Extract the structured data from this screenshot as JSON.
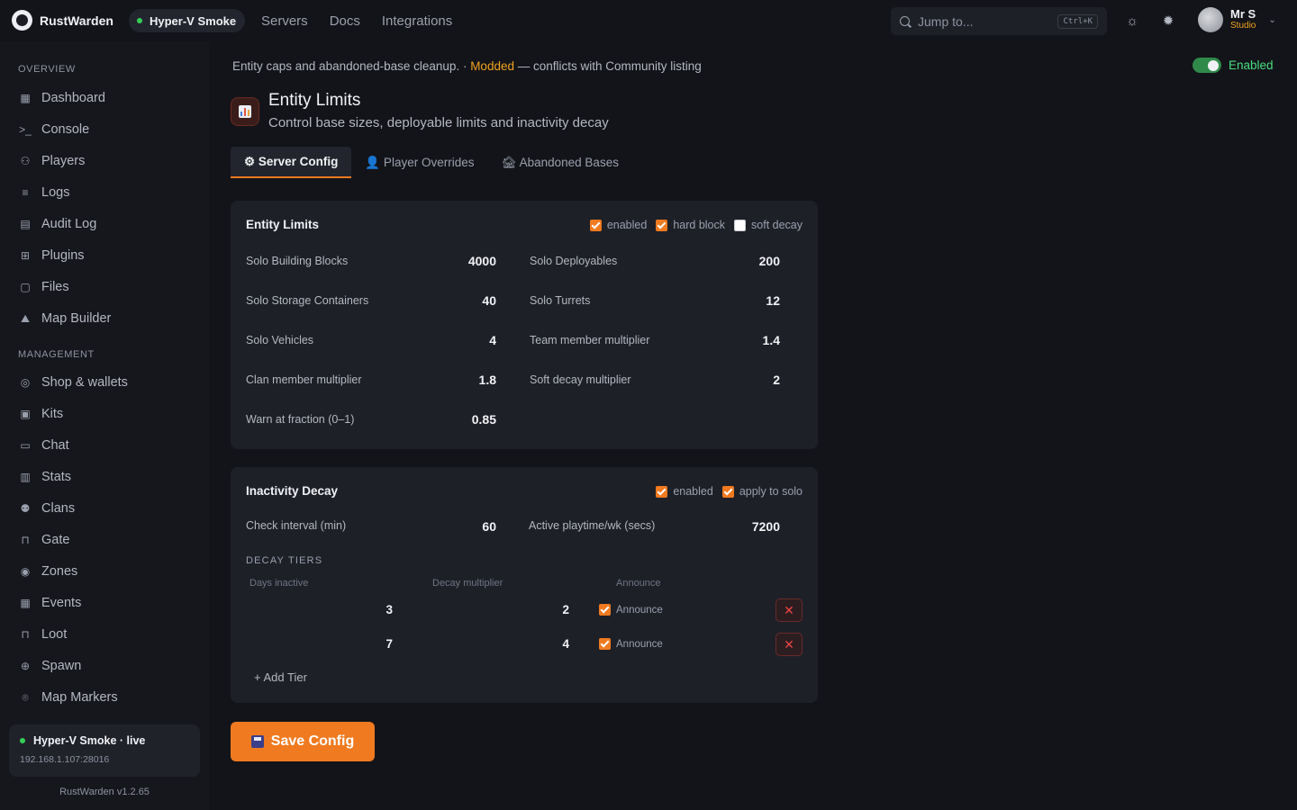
{
  "brand": {
    "name": "RustWarden"
  },
  "server_pill": {
    "label": "Hyper-V Smoke"
  },
  "topnav": [
    "Servers",
    "Docs",
    "Integrations"
  ],
  "search": {
    "placeholder": "Jump to...",
    "shortcut": "Ctrl+K"
  },
  "user": {
    "name": "Mr S",
    "role": "Studio"
  },
  "sidebar": {
    "overview_label": "OVERVIEW",
    "overview": [
      {
        "label": "Dashboard",
        "icon": "grid-icon"
      },
      {
        "label": "Console",
        "icon": "terminal-icon"
      },
      {
        "label": "Players",
        "icon": "users-icon"
      },
      {
        "label": "Logs",
        "icon": "list-icon"
      },
      {
        "label": "Audit Log",
        "icon": "clipboard-icon"
      },
      {
        "label": "Plugins",
        "icon": "puzzle-icon"
      },
      {
        "label": "Files",
        "icon": "file-icon"
      },
      {
        "label": "Map Builder",
        "icon": "map-icon"
      }
    ],
    "management_label": "MANAGEMENT",
    "management": [
      {
        "label": "Shop & wallets",
        "icon": "coin-icon"
      },
      {
        "label": "Kits",
        "icon": "package-icon"
      },
      {
        "label": "Chat",
        "icon": "chat-icon"
      },
      {
        "label": "Stats",
        "icon": "bar-chart-icon"
      },
      {
        "label": "Clans",
        "icon": "group-icon"
      },
      {
        "label": "Gate",
        "icon": "lock-icon"
      },
      {
        "label": "Zones",
        "icon": "target-icon"
      },
      {
        "label": "Events",
        "icon": "calendar-icon"
      },
      {
        "label": "Loot",
        "icon": "lock-icon"
      },
      {
        "label": "Spawn",
        "icon": "plus-circle-icon"
      },
      {
        "label": "Map Markers",
        "icon": "pin-icon"
      }
    ],
    "status": {
      "title": "Hyper-V Smoke · live",
      "ip": "192.168.1.107:28016"
    },
    "version": "RustWarden v1.2.65"
  },
  "banner": {
    "text": "Entity caps and abandoned-base cleanup. · ",
    "mod": "Modded",
    "rest": " — conflicts with Community listing",
    "toggle_label": "Enabled"
  },
  "plugin": {
    "title": "Entity Limits",
    "subtitle": "Control base sizes, deployable limits and inactivity decay"
  },
  "tabs": [
    {
      "label": "⚙ Server Config",
      "active": true
    },
    {
      "label": "👤 Player Overrides",
      "active": false
    },
    {
      "label": "🏚 Abandoned Bases",
      "active": false
    }
  ],
  "entity_limits": {
    "title": "Entity Limits",
    "checks": [
      {
        "label": "enabled",
        "checked": true
      },
      {
        "label": "hard block",
        "checked": true
      },
      {
        "label": "soft decay",
        "checked": false
      }
    ],
    "fields": [
      {
        "label": "Solo Building Blocks",
        "value": "4000"
      },
      {
        "label": "Solo Deployables",
        "value": "200"
      },
      {
        "label": "Solo Storage Containers",
        "value": "40"
      },
      {
        "label": "Solo Turrets",
        "value": "12"
      },
      {
        "label": "Solo Vehicles",
        "value": "4"
      },
      {
        "label": "Team member multiplier",
        "value": "1.4"
      },
      {
        "label": "Clan member multiplier",
        "value": "1.8"
      },
      {
        "label": "Soft decay multiplier",
        "value": "2"
      },
      {
        "label": "Warn at fraction (0–1)",
        "value": "0.85"
      }
    ]
  },
  "inactivity": {
    "title": "Inactivity Decay",
    "checks": [
      {
        "label": "enabled",
        "checked": true
      },
      {
        "label": "apply to solo",
        "checked": true
      }
    ],
    "fields": [
      {
        "label": "Check interval (min)",
        "value": "60"
      },
      {
        "label": "Active playtime/wk (secs)",
        "value": "7200"
      }
    ],
    "tiers_label": "DECAY TIERS",
    "columns": [
      "Days inactive",
      "Decay multiplier",
      "Announce"
    ],
    "tiers": [
      {
        "days": "3",
        "multiplier": "2",
        "announce": "Announce",
        "checked": true
      },
      {
        "days": "7",
        "multiplier": "4",
        "announce": "Announce",
        "checked": true
      }
    ],
    "add_label": "+ Add Tier"
  },
  "save_label": "Save Config",
  "colors": {
    "accent": "#f07a1f",
    "success": "#4ade80",
    "modded": "#f0a21f",
    "danger": "#ef4444"
  }
}
